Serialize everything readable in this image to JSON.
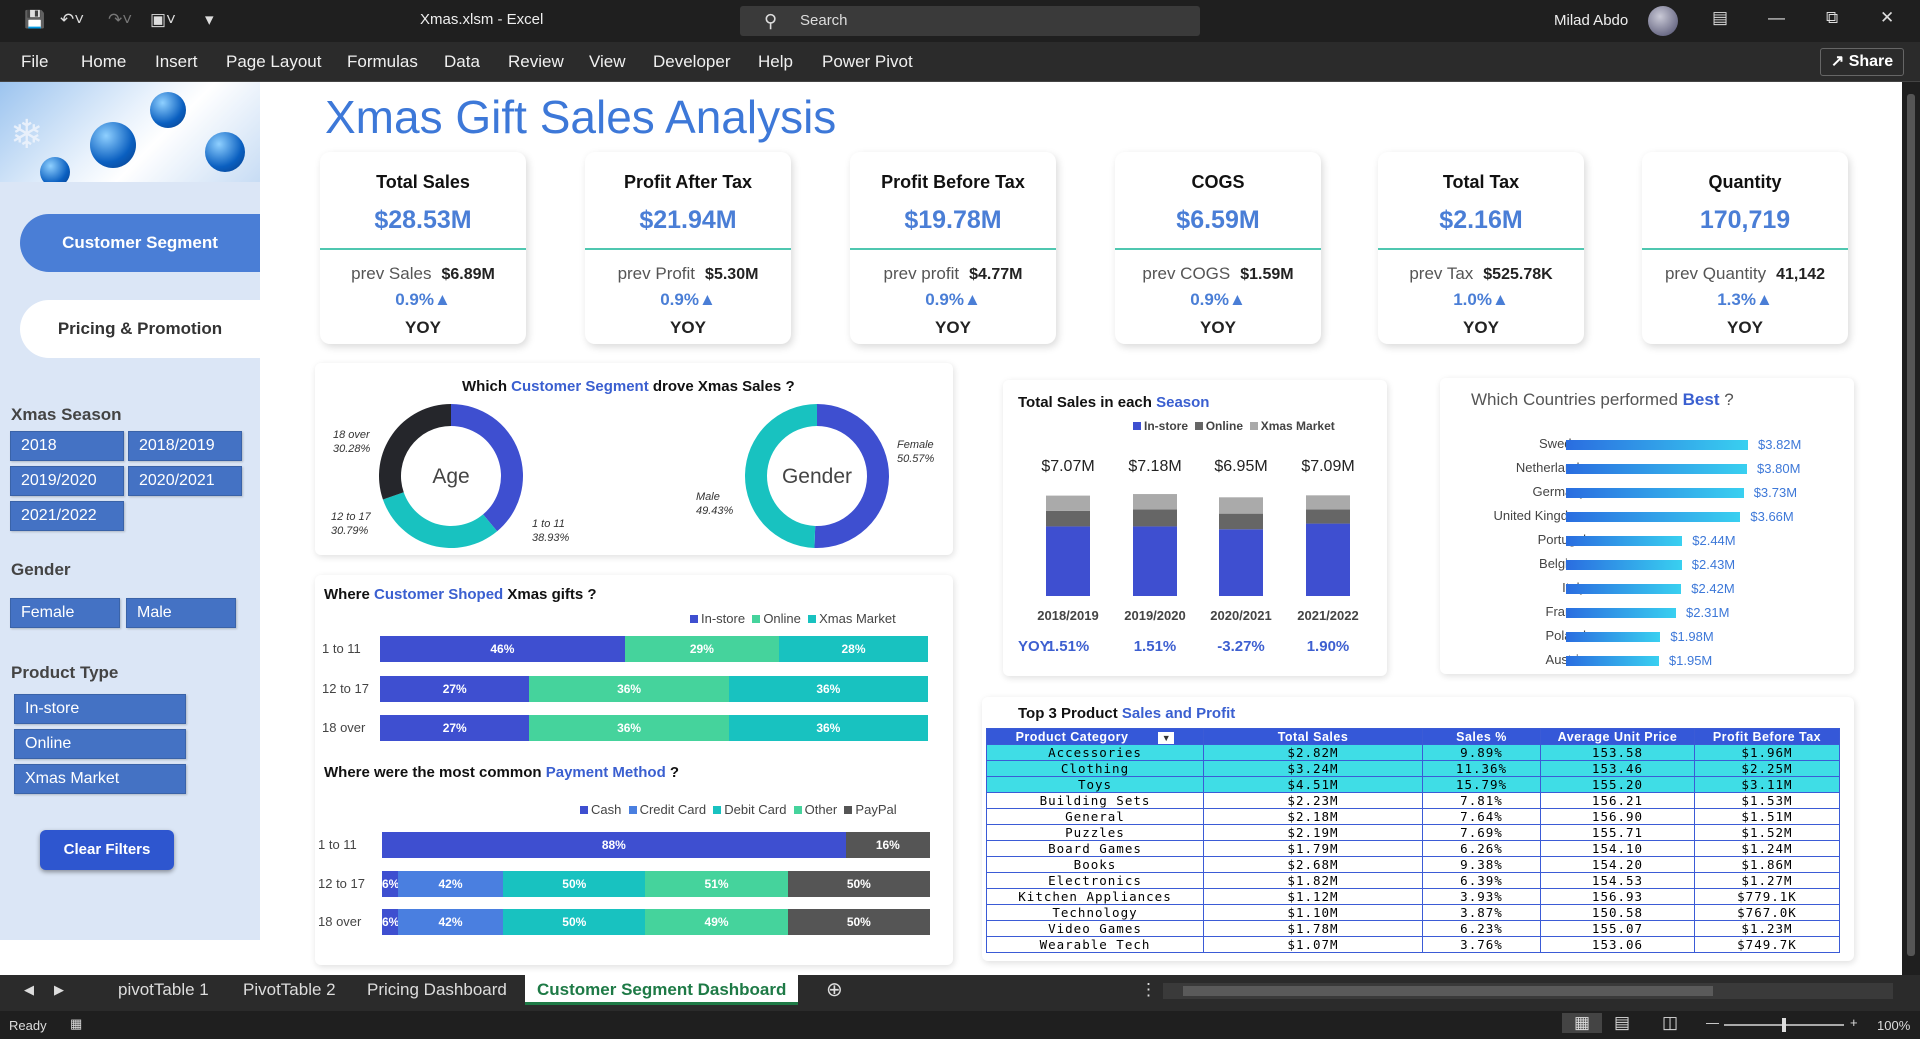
{
  "window": {
    "title": "Xmas.xlsm  -  Excel",
    "search": "Search",
    "user": "Milad Abdo"
  },
  "ribbon": {
    "tabs": [
      "File",
      "Home",
      "Insert",
      "Page Layout",
      "Formulas",
      "Data",
      "Review",
      "View",
      "Developer",
      "Help",
      "Power Pivot"
    ],
    "share": "Share"
  },
  "sidebar": {
    "nav": [
      "Customer Segment",
      "Pricing & Promotion"
    ],
    "season_title": "Xmas Season",
    "seasons": [
      "2018",
      "2018/2019",
      "2019/2020",
      "2020/2021",
      "2021/2022"
    ],
    "gender_title": "Gender",
    "genders": [
      "Female",
      "Male"
    ],
    "product_title": "Product Type",
    "products": [
      "In-store",
      "Online",
      "Xmas Market"
    ],
    "clear": "Clear Filters"
  },
  "title": "Xmas Gift Sales Analysis",
  "kpis": [
    {
      "title": "Total Sales",
      "value": "$28.53M",
      "prev_label": "prev Sales",
      "prev": "$6.89M",
      "pct": "0.9%▲",
      "yoy": "YOY"
    },
    {
      "title": "Profit After Tax",
      "value": "$21.94M",
      "prev_label": "prev Profit",
      "prev": "$5.30M",
      "pct": "0.9%▲",
      "yoy": "YOY"
    },
    {
      "title": "Profit Before Tax",
      "value": "$19.78M",
      "prev_label": "prev profit",
      "prev": "$4.77M",
      "pct": "0.9%▲",
      "yoy": "YOY"
    },
    {
      "title": "COGS",
      "value": "$6.59M",
      "prev_label": "prev COGS",
      "prev": "$1.59M",
      "pct": "0.9%▲",
      "yoy": "YOY"
    },
    {
      "title": "Total Tax",
      "value": "$2.16M",
      "prev_label": "prev Tax",
      "prev": "$525.78K",
      "pct": "1.0%▲",
      "yoy": "YOY"
    },
    {
      "title": "Quantity",
      "value": "170,719",
      "prev_label": "prev Quantity",
      "prev": "41,142",
      "pct": "1.3%▲",
      "yoy": "YOY"
    }
  ],
  "segment": {
    "h1": "Which ",
    "h2": "Customer Segment",
    "h3": " drove Xmas Sales ?",
    "age": {
      "label": "Age",
      "l1": "18 over",
      "v1": "30.28%",
      "l2": "12 to 17",
      "v2": "30.79%",
      "l3": "1 to 11",
      "v3": "38.93%"
    },
    "gender": {
      "label": "Gender",
      "l1": "Female",
      "v1": "50.57%",
      "l2": "Male",
      "v2": "49.43%"
    }
  },
  "shopped": {
    "h1": "Where ",
    "h2": "Customer Shoped",
    "h3": "  Xmas gifts ?",
    "legend": [
      "In-store",
      "Online",
      "Xmas Market"
    ],
    "rows": [
      {
        "label": "1 to 11",
        "segs": [
          "46%",
          "29%",
          "28%"
        ]
      },
      {
        "label": "12 to 17",
        "segs": [
          "27%",
          "36%",
          "36%"
        ]
      },
      {
        "label": "18 over",
        "segs": [
          "27%",
          "36%",
          "36%"
        ]
      }
    ]
  },
  "payment": {
    "h1": "Where were the most common ",
    "h2": "Payment Method",
    "h3": " ?",
    "legend": [
      "Cash",
      "Credit Card",
      "Debit Card",
      "Other",
      "PayPal"
    ],
    "rows": [
      {
        "label": "1 to 11",
        "segs": [
          "88%",
          "",
          "",
          "",
          "16%"
        ]
      },
      {
        "label": "12 to 17",
        "segs": [
          "6%",
          "42%",
          "50%",
          "51%",
          "50%"
        ]
      },
      {
        "label": "18 over",
        "segs": [
          "6%",
          "42%",
          "50%",
          "49%",
          "50%"
        ]
      }
    ]
  },
  "season_chart": {
    "h1": "Total Sales in each ",
    "h2": "Season",
    "legend": [
      "In-store",
      "Online",
      "Xmas Market"
    ],
    "yoy_label": "YOY",
    "cols": [
      {
        "cat": "2018/2019",
        "total": "$7.07M",
        "yoy": "1.51%"
      },
      {
        "cat": "2019/2020",
        "total": "$7.18M",
        "yoy": "1.51%"
      },
      {
        "cat": "2020/2021",
        "total": "$6.95M",
        "yoy": "-3.27%"
      },
      {
        "cat": "2021/2022",
        "total": "$7.09M",
        "yoy": "1.90%"
      }
    ]
  },
  "countries": {
    "h1": "Which Countries performed ",
    "h2": "Best",
    "h3": " ?"
  },
  "chart_data": [
    {
      "type": "pie",
      "categories": [
        "18 over",
        "12 to 17",
        "1 to 11"
      ],
      "values": [
        30.28,
        30.79,
        38.93
      ],
      "title": "Age"
    },
    {
      "type": "pie",
      "categories": [
        "Female",
        "Male"
      ],
      "values": [
        50.57,
        49.43
      ],
      "title": "Gender"
    },
    {
      "type": "bar",
      "title": "Total Sales in each Season",
      "categories": [
        "2018/2019",
        "2019/2020",
        "2020/2021",
        "2021/2022"
      ],
      "totals": [
        7.07,
        7.18,
        6.95,
        7.09
      ],
      "series": [
        {
          "name": "In-store",
          "values": [
            4.9,
            4.9,
            4.7,
            5.1
          ]
        },
        {
          "name": "Online",
          "values": [
            1.1,
            1.2,
            1.1,
            1.0
          ]
        },
        {
          "name": "Xmas Market",
          "values": [
            1.07,
            1.08,
            1.15,
            0.99
          ]
        }
      ]
    },
    {
      "type": "bar",
      "title": "Which Countries performed Best ?",
      "categories": [
        "Sweden",
        "Netherlands",
        "Germany",
        "United Kingdom",
        "Portugal",
        "Belgium",
        "Italy",
        "France",
        "Poland",
        "Austria"
      ],
      "values": [
        3.82,
        3.8,
        3.73,
        3.66,
        2.44,
        2.43,
        2.42,
        2.31,
        1.98,
        1.95
      ],
      "labels": [
        "$3.82M",
        "$3.80M",
        "$3.73M",
        "$3.66M",
        "$2.44M",
        "$2.43M",
        "$2.42M",
        "$2.31M",
        "$1.98M",
        "$1.95M"
      ]
    }
  ],
  "table": {
    "h1": "Top 3 Product ",
    "h2": "Sales and Profit",
    "headers": [
      "Product Category",
      "Total Sales",
      "Sales %",
      "Average Unit Price",
      "Profit Before Tax"
    ],
    "rows": [
      [
        "Accessories",
        "$2.82M",
        "9.89%",
        "153.58",
        "$1.96M"
      ],
      [
        "Clothing",
        "$3.24M",
        "11.36%",
        "153.46",
        "$2.25M"
      ],
      [
        "Toys",
        "$4.51M",
        "15.79%",
        "155.20",
        "$3.11M"
      ],
      [
        "Building Sets",
        "$2.23M",
        "7.81%",
        "156.21",
        "$1.53M"
      ],
      [
        "General",
        "$2.18M",
        "7.64%",
        "156.90",
        "$1.51M"
      ],
      [
        "Puzzles",
        "$2.19M",
        "7.69%",
        "155.71",
        "$1.52M"
      ],
      [
        "Board Games",
        "$1.79M",
        "6.26%",
        "154.10",
        "$1.24M"
      ],
      [
        "Books",
        "$2.68M",
        "9.38%",
        "154.20",
        "$1.86M"
      ],
      [
        "Electronics",
        "$1.82M",
        "6.39%",
        "154.53",
        "$1.27M"
      ],
      [
        "Kitchen Appliances",
        "$1.12M",
        "3.93%",
        "156.93",
        "$779.1K"
      ],
      [
        "Technology",
        "$1.10M",
        "3.87%",
        "150.58",
        "$767.0K"
      ],
      [
        "Video Games",
        "$1.78M",
        "6.23%",
        "155.07",
        "$1.23M"
      ],
      [
        "Wearable Tech",
        "$1.07M",
        "3.76%",
        "153.06",
        "$749.7K"
      ]
    ]
  },
  "sheets": [
    "pivotTable 1",
    "PivotTable 2",
    "Pricing Dashboard",
    "Customer Segment Dashboard"
  ],
  "status": {
    "ready": "Ready",
    "zoom": "100%"
  },
  "colors": {
    "blue": "#3e4fd0",
    "green": "#45d39c",
    "teal": "#18c2c0",
    "accent": "#4a7ed6",
    "dark": "#25262b"
  }
}
